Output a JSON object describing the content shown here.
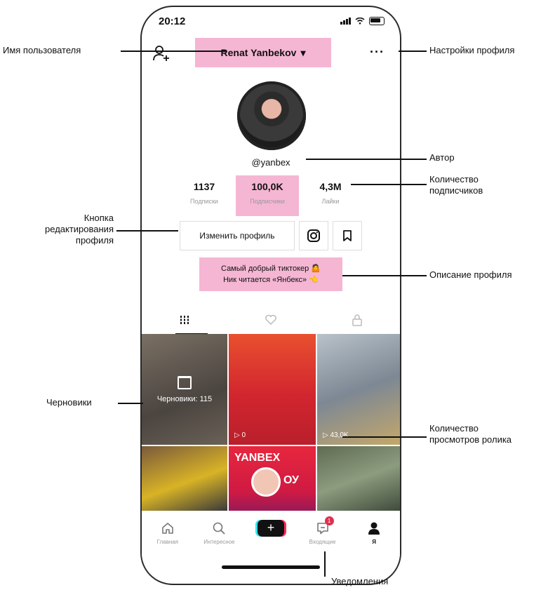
{
  "status": {
    "time": "20:12"
  },
  "header": {
    "username": "Renat Yanbekov",
    "dropdown_glyph": "▾",
    "more": "···"
  },
  "profile": {
    "handle": "@yanbex",
    "stats": [
      {
        "value": "1137",
        "label": "Подписки"
      },
      {
        "value": "100,0K",
        "label": "Подписчики"
      },
      {
        "value": "4,3M",
        "label": "Лайки"
      }
    ],
    "edit_button": "Изменить профиль",
    "bio_line1": "Самый добрый тиктокер 🤷",
    "bio_line2": "Ник читается «Янбекс» 👈"
  },
  "videos": {
    "drafts_label": "Черновики: 115",
    "v2_views": "0",
    "v3_views": "43,0K",
    "v5_title": "YANBEX",
    "v5_sub": "ОУ"
  },
  "tabbar": [
    {
      "label": "Главная"
    },
    {
      "label": "Интересное"
    },
    {
      "label": ""
    },
    {
      "label": "Входящие",
      "badge": "1"
    },
    {
      "label": "Я"
    }
  ],
  "callouts": {
    "username": "Имя пользователя",
    "settings": "Настройки профиля",
    "author": "Автор",
    "followers_line1": "Количество",
    "followers_line2": "подписчиков",
    "edit_line1": "Кнопка",
    "edit_line2": "редактирования",
    "edit_line3": "профиля",
    "description": "Описание профиля",
    "drafts": "Черновики",
    "views_line1": "Количество",
    "views_line2": "просмотров ролика",
    "notifications": "Уведомления"
  },
  "colors": {
    "highlight": "#f5b6d3",
    "accent_red": "#fe2c55",
    "accent_cyan": "#36e3ee"
  }
}
